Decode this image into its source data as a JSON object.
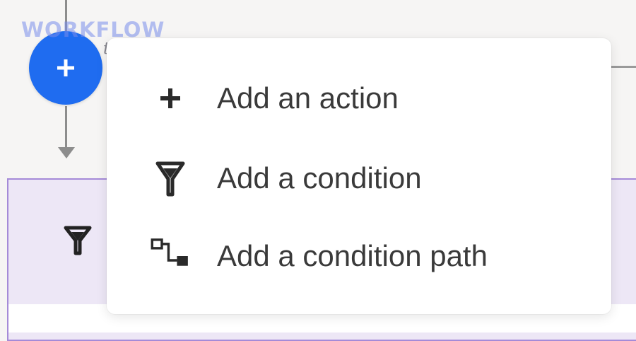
{
  "watermark": {
    "title": "WORKFLOW",
    "subtitle": "tipster.top"
  },
  "add_step": {
    "icon": "plus-icon"
  },
  "step_card": {
    "icon": "filter-icon"
  },
  "menu": {
    "items": [
      {
        "label": "Add an action",
        "icon": "plus-icon"
      },
      {
        "label": "Add a condition",
        "icon": "filter-icon"
      },
      {
        "label": "Add a condition path",
        "icon": "branch-path-icon"
      }
    ]
  },
  "colors": {
    "accent": "#1f6cf0",
    "card_bg": "#ede7f6",
    "card_border": "#a58bd8",
    "text": "#3a3a3a"
  }
}
